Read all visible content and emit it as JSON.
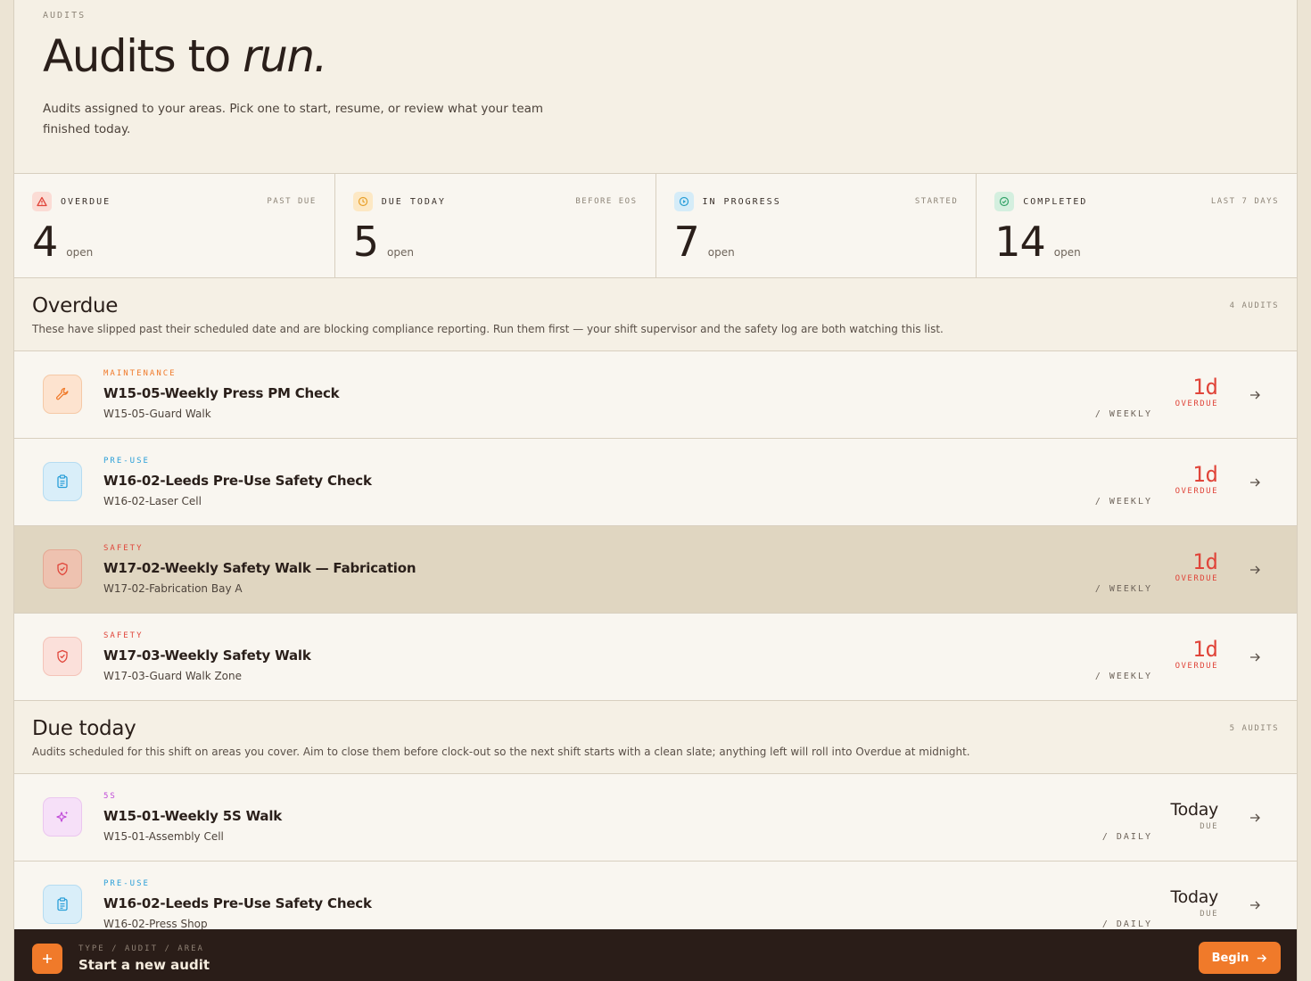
{
  "header": {
    "eyebrow": "AUDITS",
    "title_main": "Audits to ",
    "title_emphasis": "run.",
    "description": "Audits assigned to your areas. Pick one to start, resume, or review what your team finished today."
  },
  "stats": [
    {
      "label": "OVERDUE",
      "meta": "PAST DUE",
      "value": "4",
      "unit": "open",
      "icon": "warning-triangle-icon",
      "color": "#e0453a",
      "bg": "#fbdcd5"
    },
    {
      "label": "DUE TODAY",
      "meta": "BEFORE EOS",
      "value": "5",
      "unit": "open",
      "icon": "clock-icon",
      "color": "#e8a02a",
      "bg": "#fde8c4"
    },
    {
      "label": "IN PROGRESS",
      "meta": "STARTED",
      "value": "7",
      "unit": "open",
      "icon": "play-circle-icon",
      "color": "#2a9fd8",
      "bg": "#d5ecf8"
    },
    {
      "label": "COMPLETED",
      "meta": "LAST 7 DAYS",
      "value": "14",
      "unit": "open",
      "icon": "check-circle-icon",
      "color": "#34a36a",
      "bg": "#d4efdf"
    }
  ],
  "sections": {
    "overdue": {
      "title": "Overdue",
      "count": "4 AUDITS",
      "description": "These have slipped past their scheduled date and are blocking compliance reporting. Run them first — your shift supervisor and the safety log are both watching this list.",
      "rows": [
        {
          "category": "MAINTENANCE",
          "title": "W15-05-Weekly Press PM Check",
          "area": "W15-05-Guard Walk",
          "frequency": "/ WEEKLY",
          "due_value": "1d",
          "due_label": "OVERDUE",
          "icon": "wrench-icon"
        },
        {
          "category": "PRE-USE",
          "title": "W16-02-Leeds Pre-Use Safety Check",
          "area": "W16-02-Laser Cell",
          "frequency": "/ WEEKLY",
          "due_value": "1d",
          "due_label": "OVERDUE",
          "icon": "clipboard-icon"
        },
        {
          "category": "SAFETY",
          "title": "W17-02-Weekly Safety Walk — Fabrication",
          "area": "W17-02-Fabrication Bay A",
          "frequency": "/ WEEKLY",
          "due_value": "1d",
          "due_label": "OVERDUE",
          "icon": "shield-check-icon"
        },
        {
          "category": "SAFETY",
          "title": "W17-03-Weekly Safety Walk",
          "area": "W17-03-Guard Walk Zone",
          "frequency": "/ WEEKLY",
          "due_value": "1d",
          "due_label": "OVERDUE",
          "icon": "shield-check-icon"
        }
      ]
    },
    "due_today": {
      "title": "Due today",
      "count": "5 AUDITS",
      "description": "Audits scheduled for this shift on areas you cover. Aim to close them before clock-out so the next shift starts with a clean slate; anything left will roll into Overdue at midnight.",
      "rows": [
        {
          "category": "5S",
          "title": "W15-01-Weekly 5S Walk",
          "area": "W15-01-Assembly Cell",
          "frequency": "/ DAILY",
          "due_value": "Today",
          "due_label": "DUE",
          "icon": "sparkle-icon"
        },
        {
          "category": "PRE-USE",
          "title": "W16-02-Leeds Pre-Use Safety Check",
          "area": "W16-02-Press Shop",
          "frequency": "/ DAILY",
          "due_value": "Today",
          "due_label": "DUE",
          "icon": "clipboard-icon"
        }
      ]
    }
  },
  "footer": {
    "eyebrow": "TYPE / AUDIT / AREA",
    "title": "Start a new audit",
    "begin_label": "Begin"
  },
  "colors": {
    "maintenance": "#f07a2a",
    "pre_use": "#2a9fd8",
    "safety": "#e0453a",
    "five_s": "#c04ad8",
    "accent": "#f07a2a"
  }
}
